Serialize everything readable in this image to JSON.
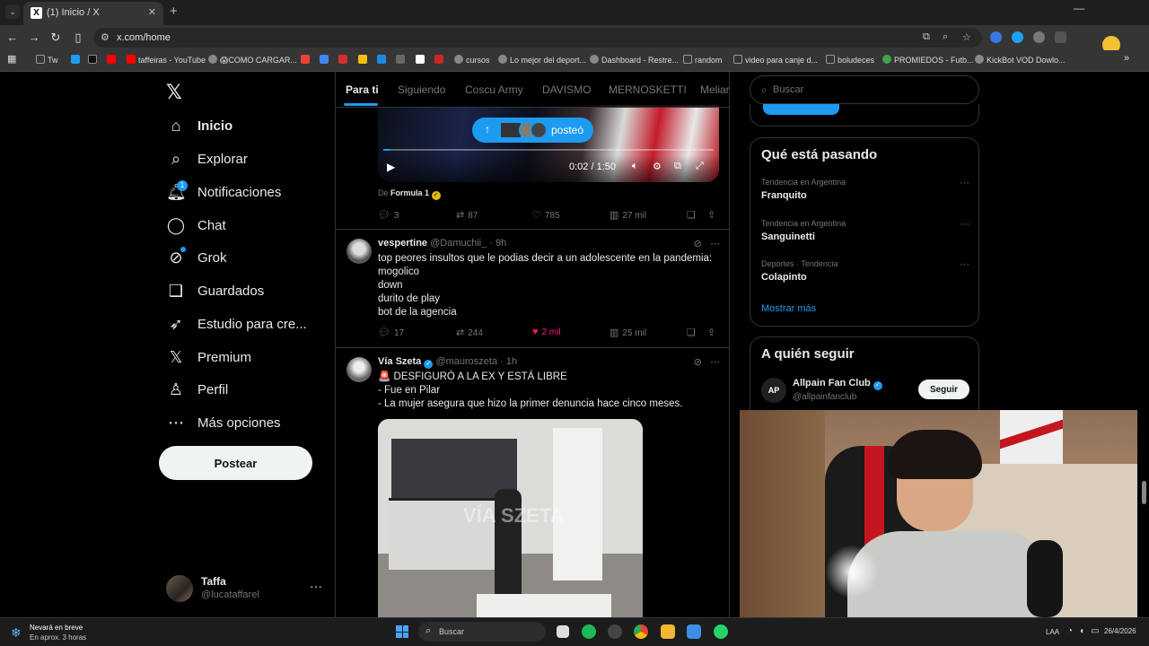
{
  "browser": {
    "tab_title": "(1) Inicio / X",
    "url": "x.com/home",
    "new_tab": "+",
    "tab_close": "✕",
    "bookmarks": [
      {
        "label": "Tw",
        "color": "#999"
      },
      {
        "label": "",
        "color": "#1d9bf0"
      },
      {
        "label": "",
        "color": "#111"
      },
      {
        "label": "",
        "color": "#ff0000"
      },
      {
        "label": "taffeiras - YouTube",
        "color": "#ff0000"
      },
      {
        "label": "😱COMO CARGAR...",
        "color": "#888"
      },
      {
        "label": "",
        "color": "#ea4335"
      },
      {
        "label": "",
        "color": "#4285f4"
      },
      {
        "label": "",
        "color": "#d32f2f"
      },
      {
        "label": "",
        "color": "#f4c20d"
      },
      {
        "label": "",
        "color": "#1e88e5"
      },
      {
        "label": "",
        "color": "#666"
      },
      {
        "label": "",
        "color": "#c62828"
      },
      {
        "label": "cursos",
        "color": "#888"
      },
      {
        "label": "Lo mejor del deport...",
        "color": "#888"
      },
      {
        "label": "Dashboard - Restre...",
        "color": "#888"
      },
      {
        "label": "random",
        "color": "#999"
      },
      {
        "label": "video para canje d...",
        "color": "#999"
      },
      {
        "label": "boludeces",
        "color": "#999"
      },
      {
        "label": "PROMIEDOS - Futb...",
        "color": "#43a047"
      },
      {
        "label": "KickBot VOD Dowlo...",
        "color": "#888"
      }
    ]
  },
  "nav": {
    "logo": "𝕏",
    "items": [
      {
        "label": "Inicio",
        "icon": "⌂",
        "active": true
      },
      {
        "label": "Explorar",
        "icon": "⌕"
      },
      {
        "label": "Notificaciones",
        "icon": "🔔︎",
        "badge": "1"
      },
      {
        "label": "Chat",
        "icon": "◯"
      },
      {
        "label": "Grok",
        "icon": "⊘"
      },
      {
        "label": "Guardados",
        "icon": "❑"
      },
      {
        "label": "Estudio para cre...",
        "icon": "➶"
      },
      {
        "label": "Premium",
        "icon": "𝕏"
      },
      {
        "label": "Perfil",
        "icon": "♙"
      },
      {
        "label": "Más opciones",
        "icon": "⋯"
      }
    ],
    "post_button": "Postear",
    "account": {
      "name": "Taffa",
      "handle": "@lucataffarel",
      "more": "···"
    }
  },
  "timeline": {
    "tabs": [
      "Para ti",
      "Siguiendo",
      "Coscu Army",
      "DAVISMO",
      "MERNOSKETTI",
      "Meliar"
    ],
    "new_posts_pill": "posteó",
    "video_post": {
      "time": "0:02 / 1:50",
      "progress": 0.02,
      "from_prefix": "De",
      "from_name": "Formula 1",
      "actions": {
        "replies": "3",
        "reposts": "87",
        "likes": "785",
        "views": "27 mil"
      }
    },
    "tweets": [
      {
        "name": "vespertine",
        "handle": "@Damuchii_",
        "time": "· 9h",
        "lines": [
          "top peores insultos que le podias decir a un adolescente en la pandemia:",
          "mogolico",
          "down",
          "durito de play",
          "bot de la agencia"
        ],
        "actions": {
          "replies": "17",
          "reposts": "244",
          "likes": "2 mil",
          "views": "25 mil"
        }
      },
      {
        "name": "Vía Szeta",
        "handle": "@mauroszeta",
        "time": "· 1h",
        "lines": [
          "🚨 DESFIGURÓ A LA EX Y ESTÁ LIBRE",
          "- Fue en Pilar",
          "- La mujer asegura que hizo la primer denuncia hace cinco meses."
        ],
        "watermark": "VÍA SZETA"
      }
    ]
  },
  "sidebar": {
    "search_placeholder": "Buscar",
    "trends_title": "Qué está pasando",
    "trends": [
      {
        "context": "Tendencia en Argentina",
        "name": "Franquito"
      },
      {
        "context": "Tendencia en Argentina",
        "name": "Sanguinetti"
      },
      {
        "context": "Deportes · Tendencia",
        "name": "Colapinto"
      }
    ],
    "show_more": "Mostrar más",
    "follow_title": "A quién seguir",
    "follow": {
      "avatar": "AP",
      "name": "Allpain Fan Club",
      "handle": "@allpainfanclub",
      "button": "Seguir"
    }
  },
  "taskbar": {
    "weather_title": "Nevará en breve",
    "weather_sub": "En aprox. 3 horas",
    "search_placeholder": "Buscar",
    "lang": "LAA",
    "date": "26/4/2026"
  },
  "colors": {
    "accent": "#1d9bf0",
    "like": "#f91880",
    "background": "#000000"
  }
}
